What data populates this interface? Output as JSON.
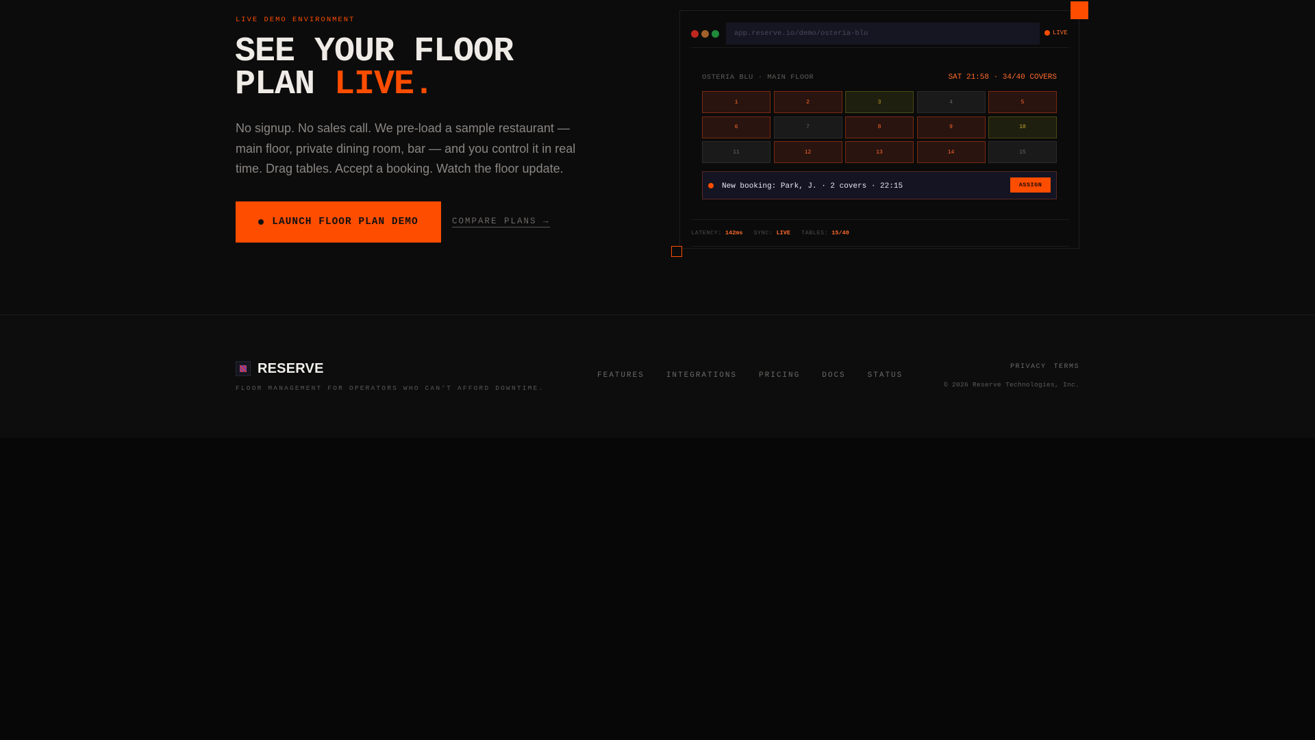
{
  "hero": {
    "eyebrow": "LIVE DEMO ENVIRONMENT",
    "headline_line1": "SEE YOUR FLOOR",
    "headline_line2_start": "PLAN ",
    "headline_accent": "LIVE.",
    "subtitle": "No signup. No sales call. We pre-load a sample restaurant — main floor, private dining room, bar — and you control it in real time. Drag tables. Accept a booking. Watch the floor update.",
    "cta_primary": "LAUNCH FLOOR PLAN DEMO",
    "cta_secondary": "COMPARE PLANS →"
  },
  "demo": {
    "url": "app.reserve.io/demo/osteria-blu",
    "live_label": "LIVE",
    "floor_name": "OSTERIA BLU · MAIN FLOOR",
    "floor_status": "SAT 21:58 · 34/40 COVERS",
    "tables": [
      {
        "number": "1",
        "status": "occupied"
      },
      {
        "number": "2",
        "status": "occupied"
      },
      {
        "number": "3",
        "status": "reserved"
      },
      {
        "number": "4",
        "status": "free"
      },
      {
        "number": "5",
        "status": "occupied"
      },
      {
        "number": "6",
        "status": "occupied"
      },
      {
        "number": "7",
        "status": "free"
      },
      {
        "number": "8",
        "status": "occupied"
      },
      {
        "number": "9",
        "status": "occupied"
      },
      {
        "number": "10",
        "status": "reserved"
      },
      {
        "number": "11",
        "status": "free"
      },
      {
        "number": "12",
        "status": "occupied"
      },
      {
        "number": "13",
        "status": "occupied"
      },
      {
        "number": "14",
        "status": "occupied"
      },
      {
        "number": "15",
        "status": "free"
      }
    ],
    "booking": {
      "text": "New booking: Park, J. · 2 covers · 22:15",
      "action": "ASSIGN"
    },
    "metrics": {
      "latency_label": "LATENCY:",
      "latency_value": "142ms",
      "sync_label": "SYNC:",
      "sync_value": "LIVE",
      "tables_label": "TABLES:",
      "tables_value": "15/40"
    }
  },
  "footer": {
    "brand": "RESERVE",
    "tagline": "FLOOR MANAGEMENT FOR OPERATORS WHO CAN'T AFFORD DOWNTIME.",
    "nav": [
      "FEATURES",
      "INTEGRATIONS",
      "PRICING",
      "DOCS",
      "STATUS"
    ],
    "legal": [
      "PRIVACY",
      "TERMS"
    ],
    "copyright": "© 2026 Reserve Technologies, Inc."
  },
  "colors": {
    "accent": "#ff4d00",
    "background": "#0c0c0c",
    "traffic_red": "#c1271f",
    "traffic_yellow": "#a0622a",
    "traffic_green": "#1f8a3a"
  }
}
